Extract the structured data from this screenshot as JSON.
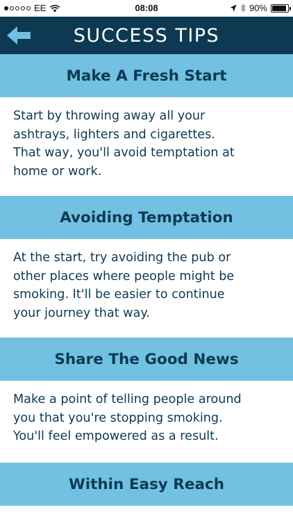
{
  "status_bar": {
    "carrier": "EE",
    "time": "08:08",
    "battery": "90%",
    "battery_level": 0.9,
    "signal_dots_filled": 1,
    "signal_dots_total": 5,
    "icons": [
      "wifi-icon",
      "location-arrow-icon",
      "bluetooth-icon",
      "battery-icon"
    ]
  },
  "nav": {
    "title": "SUCCESS TIPS",
    "back_icon": "back-arrow-icon"
  },
  "colors": {
    "nav_background": "#0d3a52",
    "header_background": "#72c1e3",
    "text": "#0d3a52"
  },
  "tips": [
    {
      "title": "Make A Fresh Start",
      "body": "Start by throwing away all your\nashtrays, lighters and cigarettes.\nThat way, you'll avoid temptation at\nhome or work."
    },
    {
      "title": "Avoiding Temptation",
      "body": "At the start, try avoiding the pub or\nother places where people might be\nsmoking. It'll be easier to continue\nyour journey that way."
    },
    {
      "title": "Share The Good News",
      "body": "Make a point of telling people around\nyou that you're stopping smoking.\nYou'll feel empowered as a result."
    },
    {
      "title": "Within Easy Reach",
      "body": ""
    }
  ]
}
